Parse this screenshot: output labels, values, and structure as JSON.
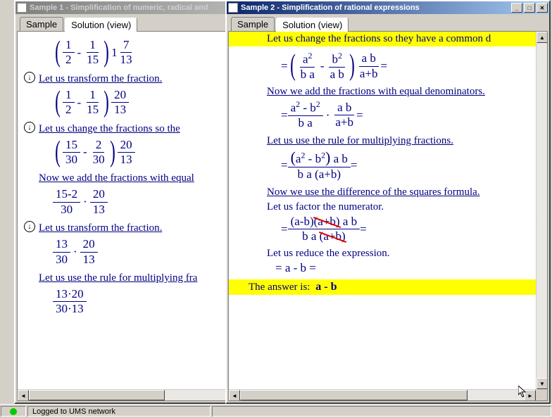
{
  "window1": {
    "title": "Sample 1 - Simplification of numeric, radical and",
    "tabs": {
      "sample": "Sample",
      "solution": "Solution (view)"
    },
    "steps": {
      "s1": "Let us transform the fraction.",
      "s2": "Let us change the fractions so the",
      "s3": "Now we add the fractions with equal",
      "s4": "Let us transform the fraction.",
      "s5": "Let us use the rule for multiplying fra"
    },
    "math": {
      "m1": {
        "a": "1",
        "b": "2",
        "c": "1",
        "d": "15",
        "post": "1",
        "e": "7",
        "f": "13"
      },
      "m2": {
        "a": "1",
        "b": "2",
        "c": "1",
        "d": "15",
        "e": "20",
        "f": "13"
      },
      "m3": {
        "a": "15",
        "b": "30",
        "c": "2",
        "d": "30",
        "e": "20",
        "f": "13"
      },
      "m4": {
        "n": "15-2",
        "d": "30",
        "n2": "20",
        "d2": "13"
      },
      "m5": {
        "n": "13",
        "d": "30",
        "n2": "20",
        "d2": "13"
      },
      "m6": {
        "n": "13·20",
        "d": "30·13"
      }
    }
  },
  "window2": {
    "title": "Sample 2 - Simplification of rational expressions",
    "tabs": {
      "sample": "Sample",
      "solution": "Solution (view)"
    },
    "banner": "Let us change the fractions so they have a common d",
    "steps": {
      "s1": "Now we add the fractions with equal denominators.",
      "s2": "Let us use the rule for multiplying fractions.",
      "s3": "Now we use the difference of the squares formula.",
      "s4": "Let us factor the numerator.",
      "s5": "Let us reduce the expression.",
      "answer_label": "The answer is:",
      "answer": "a - b"
    },
    "exp": {
      "e1": {
        "n1": "a",
        "d1": "b a",
        "n2": "b",
        "d2": "a b",
        "n3": "a b",
        "d3": "a+b"
      },
      "e2": {
        "n1": "a",
        "n2": "b",
        "d": "b a",
        "n3": "a b",
        "d3": "a+b"
      },
      "e3": {
        "num": "(a  - b  ) a b",
        "den": "b a (a+b)"
      },
      "e4": {
        "p1": "(a-b)",
        "p2": "(a+b)",
        "p3": "a b",
        "dpre": "b a",
        "d2": "(a+b)"
      },
      "e5": "= a - b ="
    }
  },
  "status": {
    "text": "Logged to UMS network"
  }
}
